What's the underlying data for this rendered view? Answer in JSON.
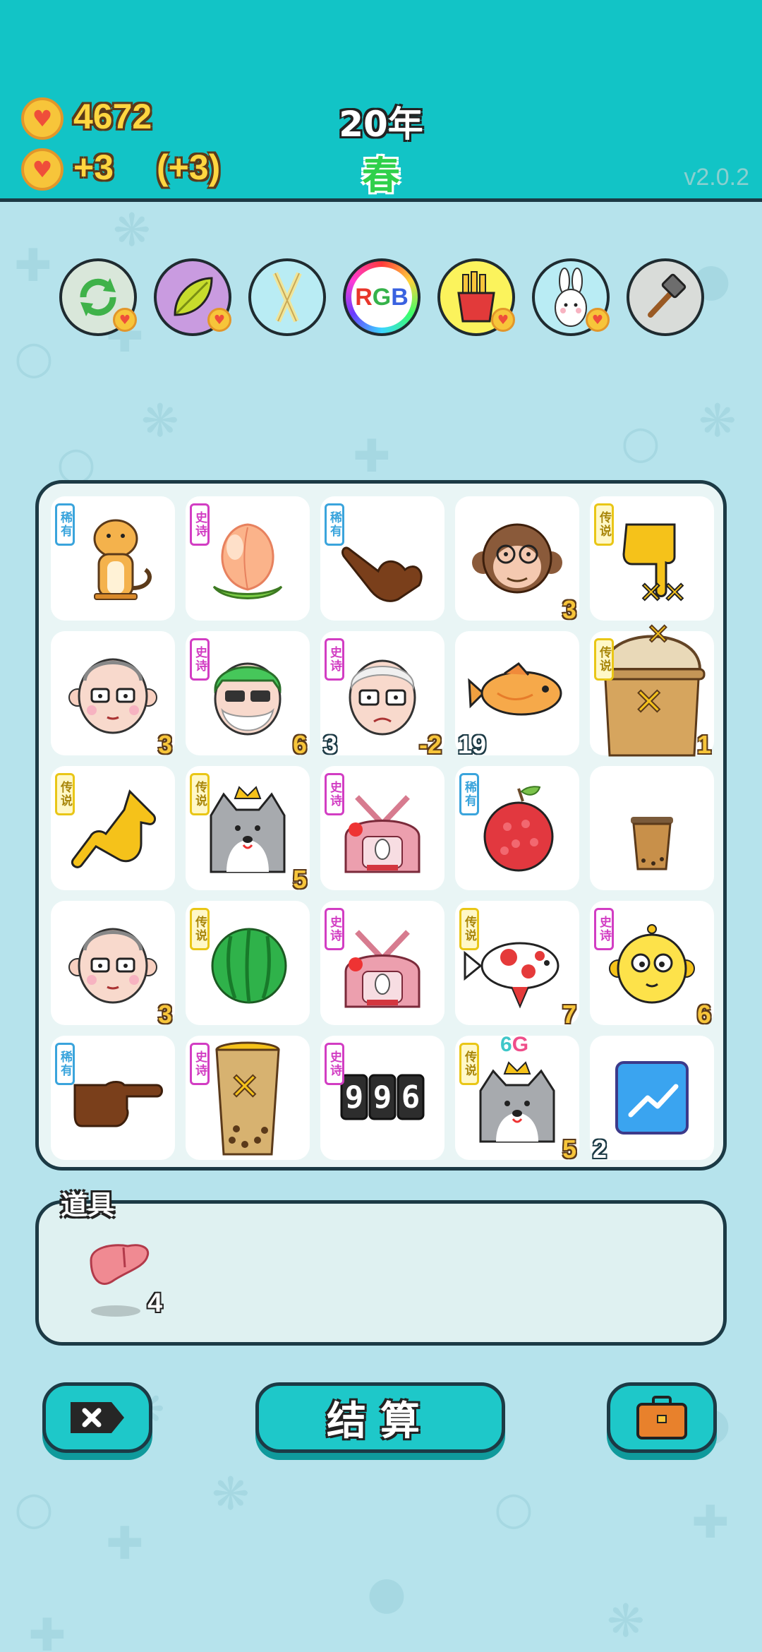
{
  "header": {
    "coins": "4672",
    "income": "+3",
    "income_bonus": "(+3)",
    "year": "20年",
    "season": "春",
    "version": "v2.0.2"
  },
  "tools": [
    {
      "name": "refresh",
      "icon": "refresh-icon"
    },
    {
      "name": "leaf",
      "icon": "leaf-icon"
    },
    {
      "name": "straws",
      "icon": "straws-icon"
    },
    {
      "name": "rgb",
      "icon": "rgb-icon",
      "text": "RGB"
    },
    {
      "name": "fries",
      "icon": "fries-icon"
    },
    {
      "name": "rabbit",
      "icon": "rabbit-icon"
    },
    {
      "name": "hammer",
      "icon": "hammer-icon"
    }
  ],
  "board": {
    "rows": [
      [
        {
          "item": "tiger",
          "tag": "稀有",
          "num_r": ""
        },
        {
          "item": "peach",
          "tag": "史诗",
          "num_r": ""
        },
        {
          "item": "brown-pointing-hand",
          "tag": "稀有",
          "num_r": ""
        },
        {
          "item": "monkey",
          "tag": "",
          "num_r": "3"
        },
        {
          "item": "yellow-pointing-hand-down",
          "tag": "传说",
          "num_r": ""
        }
      ],
      [
        {
          "item": "old-man",
          "tag": "",
          "num_r": "3"
        },
        {
          "item": "green-hair-man",
          "tag": "史诗",
          "num_r": "6"
        },
        {
          "item": "grandpa",
          "tag": "史诗",
          "num_l": "3",
          "num_r": "-2"
        },
        {
          "item": "fish",
          "tag": "",
          "num_l": "19"
        },
        {
          "item": "bubble-tea-cup",
          "tag": "传说",
          "num_r": "1"
        }
      ],
      [
        {
          "item": "yellow-pointing-hand",
          "tag": "传说",
          "num_r": ""
        },
        {
          "item": "husky-king",
          "tag": "传说",
          "num_r": "5"
        },
        {
          "item": "rabbit-house",
          "tag": "史诗",
          "num_r": ""
        },
        {
          "item": "lychee",
          "tag": "稀有",
          "num_r": ""
        },
        {
          "item": "small-tea-cup",
          "tag": "",
          "num_r": ""
        }
      ],
      [
        {
          "item": "old-man",
          "tag": "",
          "num_r": "3"
        },
        {
          "item": "watermelon",
          "tag": "传说",
          "num_r": ""
        },
        {
          "item": "rabbit-house",
          "tag": "史诗",
          "num_r": ""
        },
        {
          "item": "koi-fish",
          "tag": "传说",
          "num_r": "7"
        },
        {
          "item": "yellow-face",
          "tag": "史诗",
          "num_r": "6"
        }
      ],
      [
        {
          "item": "brown-pointing-hand-right",
          "tag": "稀有",
          "num_r": ""
        },
        {
          "item": "tall-tea-cup",
          "tag": "史诗",
          "num_r": ""
        },
        {
          "item": "counter-996",
          "tag": "史诗",
          "num_r": "",
          "text": "996"
        },
        {
          "item": "husky-king-6g",
          "tag": "传说",
          "num_r": "5",
          "over": "6G"
        },
        {
          "item": "stock-chart",
          "tag": "",
          "num_l": "2"
        }
      ]
    ]
  },
  "items_panel": {
    "label": "道具",
    "items": [
      {
        "name": "liver",
        "count": "4"
      }
    ]
  },
  "buttons": {
    "settle": "结算"
  },
  "colors": {
    "header": "#12c4c6",
    "background": "#b6e3ec",
    "gold": "#f7c53a",
    "button": "#1ec8c9"
  }
}
